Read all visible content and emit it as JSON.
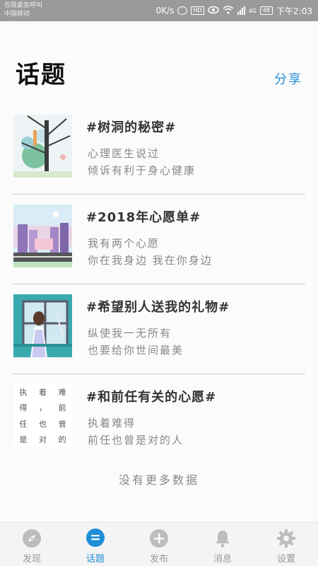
{
  "status_bar": {
    "carrier_line1": "仅限紧急呼叫",
    "carrier_line2": "中国移动",
    "net_speed": "0K/s",
    "hd_badge": "HD",
    "signal_label": "4G",
    "battery": "48",
    "time": "下午2:03"
  },
  "header": {
    "title": "话题",
    "share_label": "分享"
  },
  "topics": [
    {
      "title": "#树洞的秘密#",
      "line1": "心理医生说过",
      "line2": "倾诉有利于身心健康"
    },
    {
      "title": "#2018年心愿单#",
      "line1": "我有两个心愿",
      "line2": "你在我身边 我在你身边"
    },
    {
      "title": "#希望别人送我的礼物#",
      "line1": "纵使我一无所有",
      "line2": "也要给你世间最美"
    },
    {
      "title": "#和前任有关的心愿#",
      "line1": "执着难得",
      "line2": "前任也曾是对的人"
    }
  ],
  "thumb4_text": [
    "执",
    "着",
    "难",
    "得",
    "，",
    "前",
    "任",
    "也",
    "曾",
    "是",
    "对",
    "的"
  ],
  "no_more": "没有更多数据",
  "tabs": [
    {
      "label": "发现",
      "icon": "compass-icon"
    },
    {
      "label": "话题",
      "icon": "chat-icon"
    },
    {
      "label": "发布",
      "icon": "plus-icon"
    },
    {
      "label": "消息",
      "icon": "bell-icon"
    },
    {
      "label": "设置",
      "icon": "gear-icon"
    }
  ],
  "colors": {
    "accent": "#1f8fd6",
    "inactive": "#bdbdbd",
    "status_bar": "#9a9a9a"
  }
}
